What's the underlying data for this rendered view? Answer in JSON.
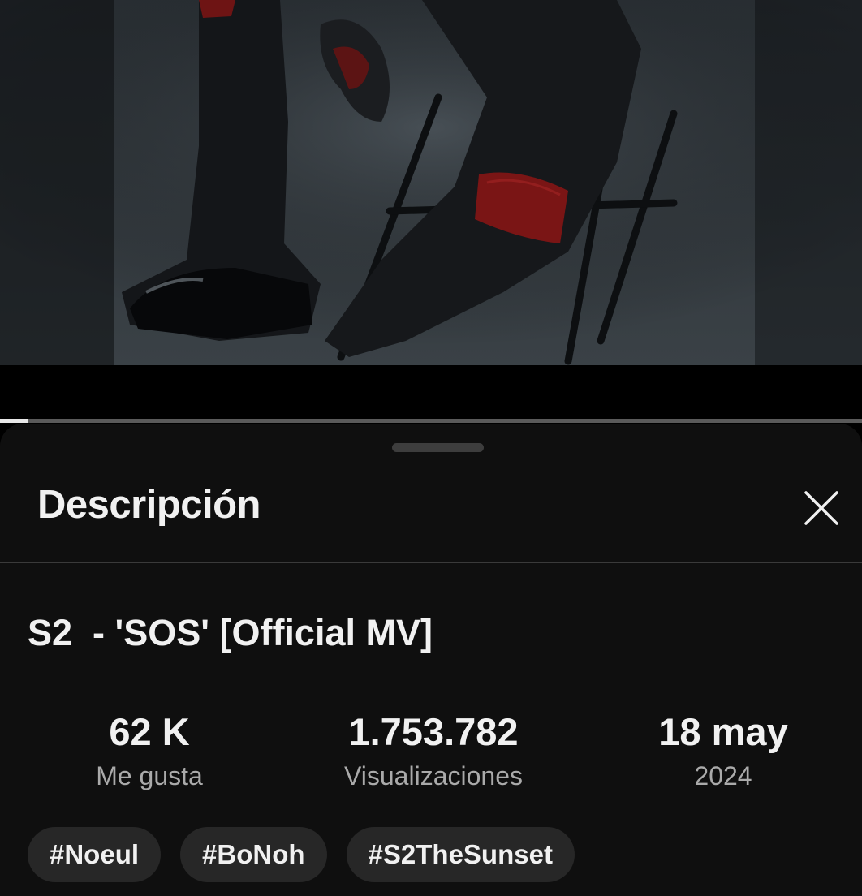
{
  "player": {
    "progress_fraction": 0.033
  },
  "description_sheet": {
    "title": "Descripción",
    "close_icon": "close-icon"
  },
  "video": {
    "title": "S2  - 'SOS' [Official MV]",
    "stats": [
      {
        "value": "62 K",
        "label": "Me gusta"
      },
      {
        "value": "1.753.782",
        "label": "Visualizaciones"
      },
      {
        "value": "18 may",
        "label": "2024"
      }
    ],
    "hashtags": [
      "#Noeul",
      "#BoNoh",
      "#S2TheSunset"
    ]
  },
  "colors": {
    "sheet_background": "#0f0f0f",
    "chip_background": "#272727",
    "secondary_text": "#aaaaaa",
    "progress_fill": "#e8e8e8",
    "accent_red": "#8b1a1a"
  }
}
